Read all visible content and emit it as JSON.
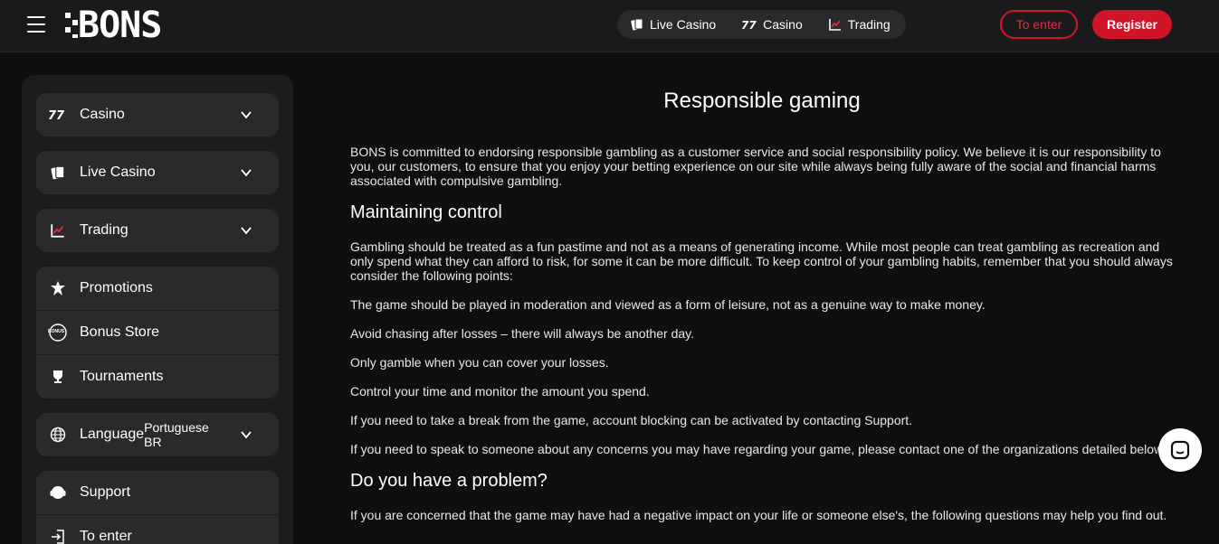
{
  "header": {
    "logo": "BONS",
    "nav": [
      {
        "label": "Live Casino",
        "icon": "cards-icon"
      },
      {
        "label": "Casino",
        "icon": "slot-777-icon"
      },
      {
        "label": "Trading",
        "icon": "chart-icon"
      }
    ],
    "login_label": "To enter",
    "register_label": "Register"
  },
  "sidebar": {
    "casino": "Casino",
    "live_casino": "Live Casino",
    "trading": "Trading",
    "promotions": "Promotions",
    "bonus_store": "Bonus Store",
    "bonus_badge": "BONUS",
    "tournaments": "Tournaments",
    "language_label": "Language",
    "language_value": "Portuguese BR",
    "support": "Support",
    "to_enter": "To enter"
  },
  "content": {
    "title": "Responsible gaming",
    "intro": "BONS is committed to endorsing responsible gambling as a customer service and social responsibility policy. We believe it is our responsibility to you, our customers, to ensure that you enjoy your betting experience on our site while always being fully aware of the social and financial harms associated with compulsive gambling.",
    "h_control": "Maintaining control",
    "control_intro": "Gambling should be treated as a fun pastime and not as a means of generating income. While most people can treat gambling as recreation and only spend what they can afford to risk, for some it can be more difficult. To keep control of your gambling habits, remember that you should always consider the following points:",
    "points": [
      "The game should be played in moderation and viewed as a form of leisure, not as a genuine way to make money.",
      "Avoid chasing after losses – there will always be another day.",
      "Only gamble when you can cover your losses.",
      "Control your time and monitor the amount you spend.",
      "If you need to take a break from the game, account blocking can be activated by contacting Support.",
      "If you need to speak to someone about any concerns you may have regarding your game, please contact one of the organizations detailed below"
    ],
    "h_problem": "Do you have a problem?",
    "problem_intro": "If you are concerned that the game may have had a negative impact on your life or someone else's, the following questions may help you find out."
  },
  "colors": {
    "accent": "#d0152a",
    "background": "#0f0f10",
    "panel": "#1c1c1e",
    "card": "#2a2a2d"
  }
}
